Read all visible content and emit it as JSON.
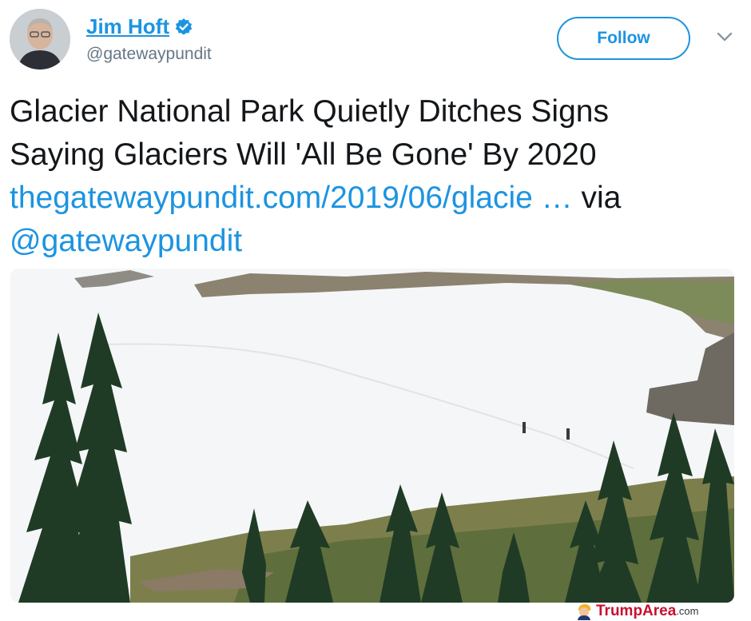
{
  "author": {
    "name": "Jim Hoft",
    "handle": "@gatewaypundit",
    "verified": true,
    "avatar_icon": "user-avatar-photo"
  },
  "actions": {
    "follow_label": "Follow",
    "menu_icon": "chevron-down-icon"
  },
  "tweet": {
    "line1": "Glacier National Park Quietly Ditches Signs",
    "line2": "Saying Glaciers Will 'All Be Gone' By 2020",
    "link_text": "thegatewaypundit.com/2019/06/glacie",
    "ellipsis": " … ",
    "via": "via",
    "mention": "@gatewaypundit"
  },
  "media": {
    "alt_icon": "glacier-photo"
  },
  "watermark": {
    "brand": "TrumpArea",
    "suffix": ".com"
  },
  "colors": {
    "accent": "#1c94e0",
    "text": "#14171a",
    "muted": "#657786",
    "watermark": "#c8102e"
  }
}
